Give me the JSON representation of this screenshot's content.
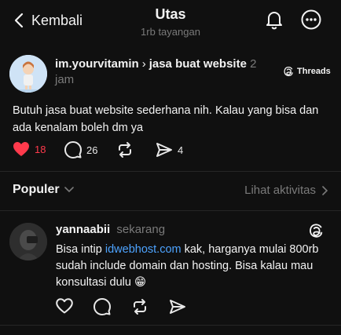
{
  "header": {
    "back_label": "Kembali",
    "title": "Utas",
    "subtitle": "1rb tayangan"
  },
  "post": {
    "username": "im.yourvitamin",
    "separator": "›",
    "topic": "jasa buat website",
    "time_value": "2",
    "time_unit": "jam",
    "badge": "Threads",
    "text": "Butuh jasa buat website sederhana nih. Kalau yang bisa dan ada kenalam boleh dm ya",
    "likes": "18",
    "replies": "26",
    "shares": "4"
  },
  "sort": {
    "label": "Populer",
    "activity_label": "Lihat aktivitas"
  },
  "reply": {
    "username": "yannaabii",
    "time": "sekarang",
    "text_before": "Bisa intip ",
    "link": "idwebhost.com",
    "text_after": " kak, harganya mulai 800rb sudah include domain dan hosting. Bisa kalau mau konsultasi dulu 😁"
  },
  "colors": {
    "background": "#101010",
    "like_red": "#ff3a4c",
    "link_blue": "#4da3ff",
    "muted": "#7a7a7a"
  }
}
